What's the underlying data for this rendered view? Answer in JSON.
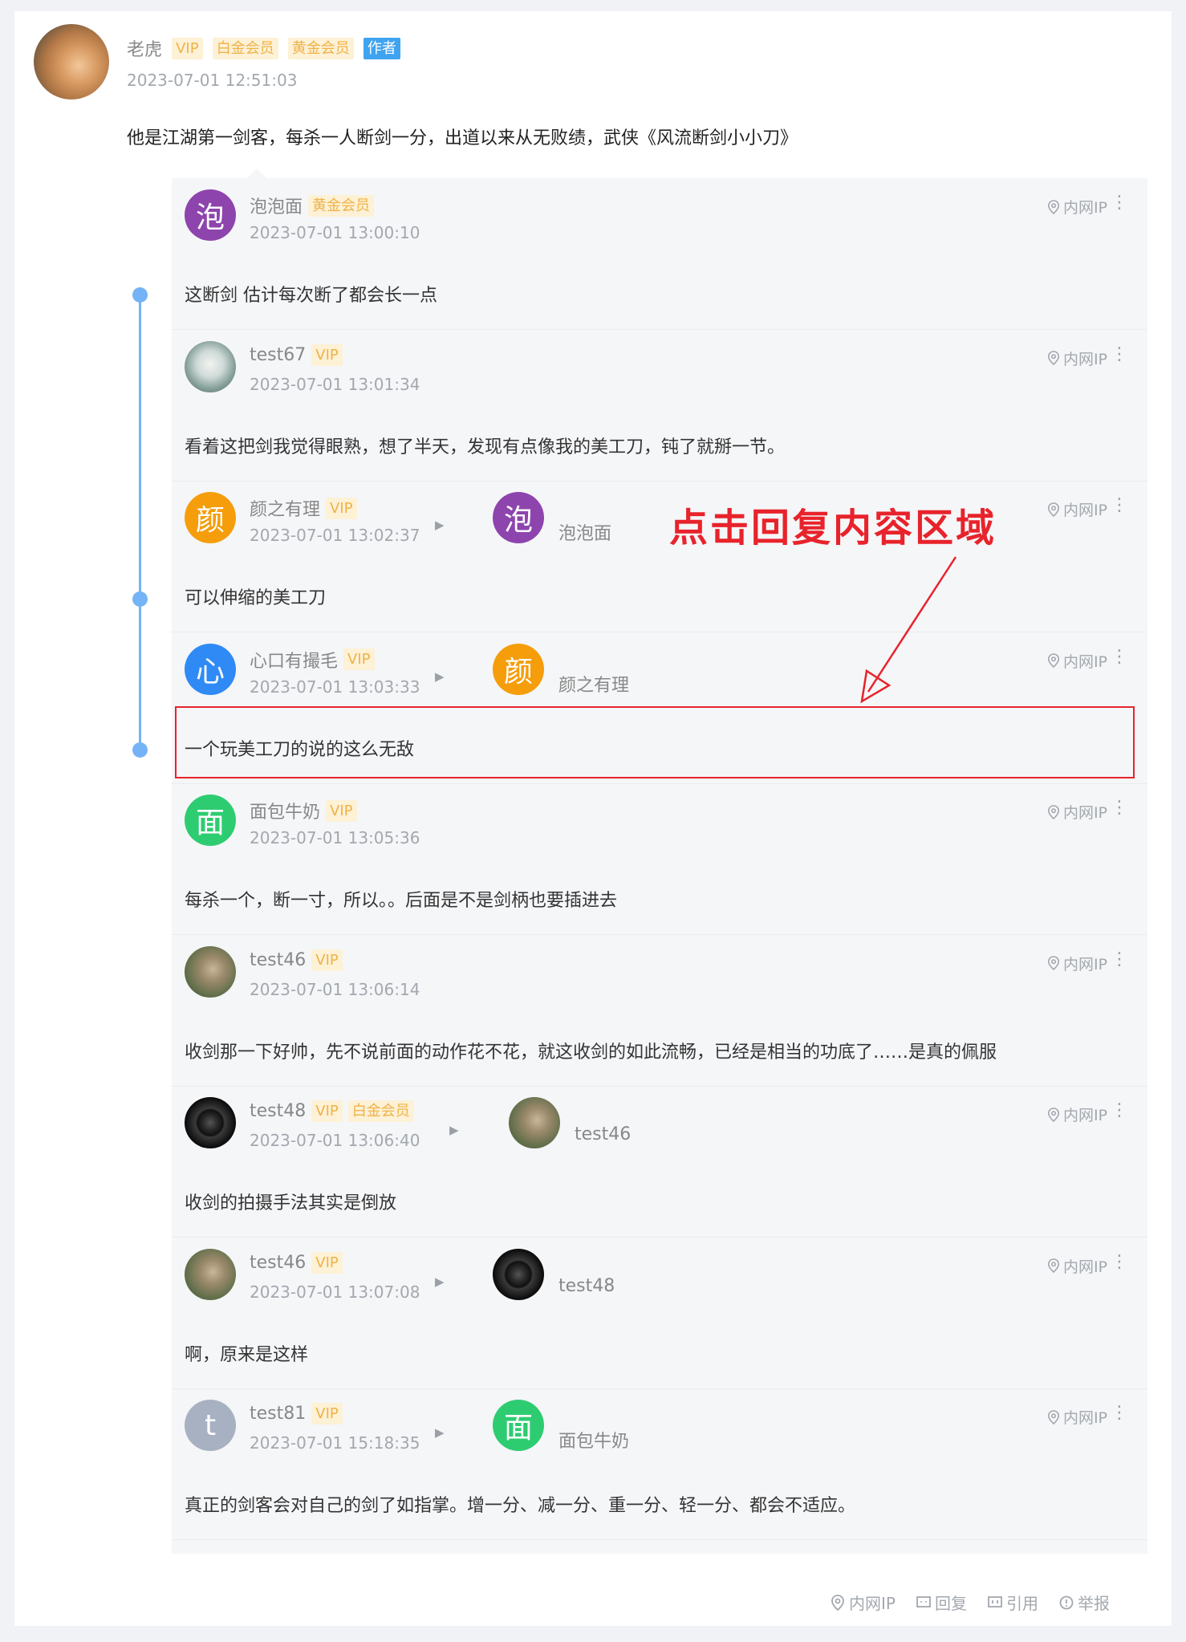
{
  "post": {
    "author": "老虎",
    "badges": [
      "VIP",
      "白金会员",
      "黄金会员",
      "作者"
    ],
    "time": "2023-07-01 12:51:03",
    "content": "他是江湖第一剑客，每杀一人断剑一分，出道以来从无败绩，武侠《风流断剑小小刀》"
  },
  "replies": [
    {
      "name": "泡泡面",
      "badges": [
        "黄金会员"
      ],
      "time": "2023-07-01 13:00:10",
      "avatar_char": "泡",
      "avatar_color": "#8e44ad",
      "content": "这断剑 估计每次断了都会长一点",
      "ip": "内网IP"
    },
    {
      "name": "test67",
      "badges": [
        "VIP"
      ],
      "time": "2023-07-01 13:01:34",
      "avatar_char": "",
      "avatar_color": "",
      "content": "看着这把剑我觉得眼熟，想了半天，发现有点像我的美工刀，钝了就掰一节。",
      "ip": "内网IP"
    },
    {
      "name": "颜之有理",
      "badges": [
        "VIP"
      ],
      "time": "2023-07-01 13:02:37",
      "avatar_char": "颜",
      "avatar_color": "#f59d0b",
      "reply_to": {
        "name": "泡泡面",
        "avatar_char": "泡",
        "avatar_color": "#8e44ad"
      },
      "content": "可以伸缩的美工刀",
      "ip": "内网IP"
    },
    {
      "name": "心口有撮毛",
      "badges": [
        "VIP"
      ],
      "time": "2023-07-01 13:03:33",
      "avatar_char": "心",
      "avatar_color": "#2f8af5",
      "reply_to": {
        "name": "颜之有理",
        "avatar_char": "颜",
        "avatar_color": "#f59d0b"
      },
      "content": "一个玩美工刀的说的这么无敌",
      "ip": "内网IP"
    },
    {
      "name": "面包牛奶",
      "badges": [
        "VIP"
      ],
      "time": "2023-07-01 13:05:36",
      "avatar_char": "面",
      "avatar_color": "#2ecc71",
      "content": "每杀一个，断一寸，所以。。后面是不是剑柄也要插进去",
      "ip": "内网IP"
    },
    {
      "name": "test46",
      "badges": [
        "VIP"
      ],
      "time": "2023-07-01 13:06:14",
      "avatar_char": "",
      "avatar_color": "",
      "content": "收剑那一下好帅，先不说前面的动作花不花，就这收剑的如此流畅，已经是相当的功底了……是真的佩服",
      "ip": "内网IP"
    },
    {
      "name": "test48",
      "badges": [
        "VIP",
        "白金会员"
      ],
      "time": "2023-07-01 13:06:40",
      "avatar_char": "",
      "avatar_color": "",
      "reply_to": {
        "name": "test46",
        "avatar_char": "",
        "avatar_color": ""
      },
      "content": "收剑的拍摄手法其实是倒放",
      "ip": "内网IP"
    },
    {
      "name": "test46",
      "badges": [
        "VIP"
      ],
      "time": "2023-07-01 13:07:08",
      "avatar_char": "",
      "avatar_color": "",
      "reply_to": {
        "name": "test48",
        "avatar_char": "",
        "avatar_color": ""
      },
      "content": "啊，原来是这样",
      "ip": "内网IP"
    },
    {
      "name": "test81",
      "badges": [
        "VIP"
      ],
      "time": "2023-07-01 15:18:35",
      "avatar_char": "t",
      "avatar_color": "#a8b1c2",
      "reply_to": {
        "name": "面包牛奶",
        "avatar_char": "面",
        "avatar_color": "#2ecc71"
      },
      "content": "真正的剑客会对自己的剑了如指掌。增一分、减一分、重一分、轻一分、都会不适应。",
      "ip": "内网IP"
    }
  ],
  "annotation": "点击回复内容区域",
  "footer": {
    "ip": "内网IP",
    "reply": "回复",
    "quote": "引用",
    "report": "举报"
  },
  "icons": {
    "more": "more-vertical-icon",
    "location": "location-pin-icon",
    "arrow": "reply-arrow-icon"
  },
  "colors": {
    "accent_red": "#e8232b",
    "timeline": "#74b3f5",
    "badge_bg": "#fdf1d6",
    "badge_text": "#f0b247",
    "author_badge": "#3fa3f0"
  }
}
